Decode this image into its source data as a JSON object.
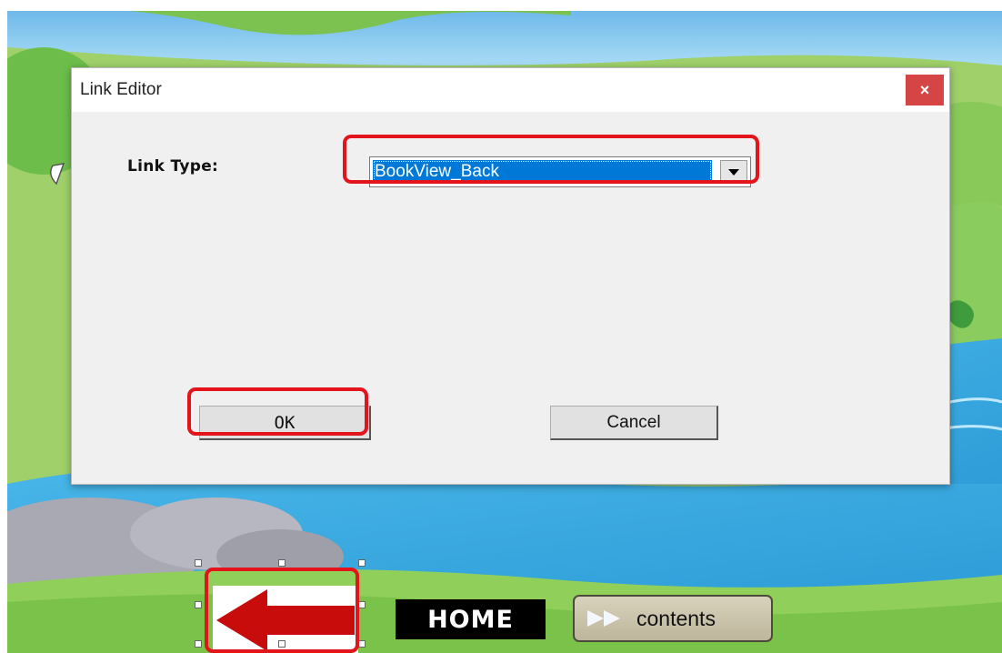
{
  "dialog": {
    "title": "Link Editor",
    "close_label": "×",
    "link_type_label": "Link Type:",
    "link_type_value": "BookView_Back",
    "ok_label": "OK",
    "cancel_label": "Cancel"
  },
  "nav": {
    "home_label": "HOME",
    "contents_label": "contents"
  },
  "colors": {
    "highlight": "#e3141b",
    "selection": "#0078d7",
    "close_button": "#d64545"
  }
}
